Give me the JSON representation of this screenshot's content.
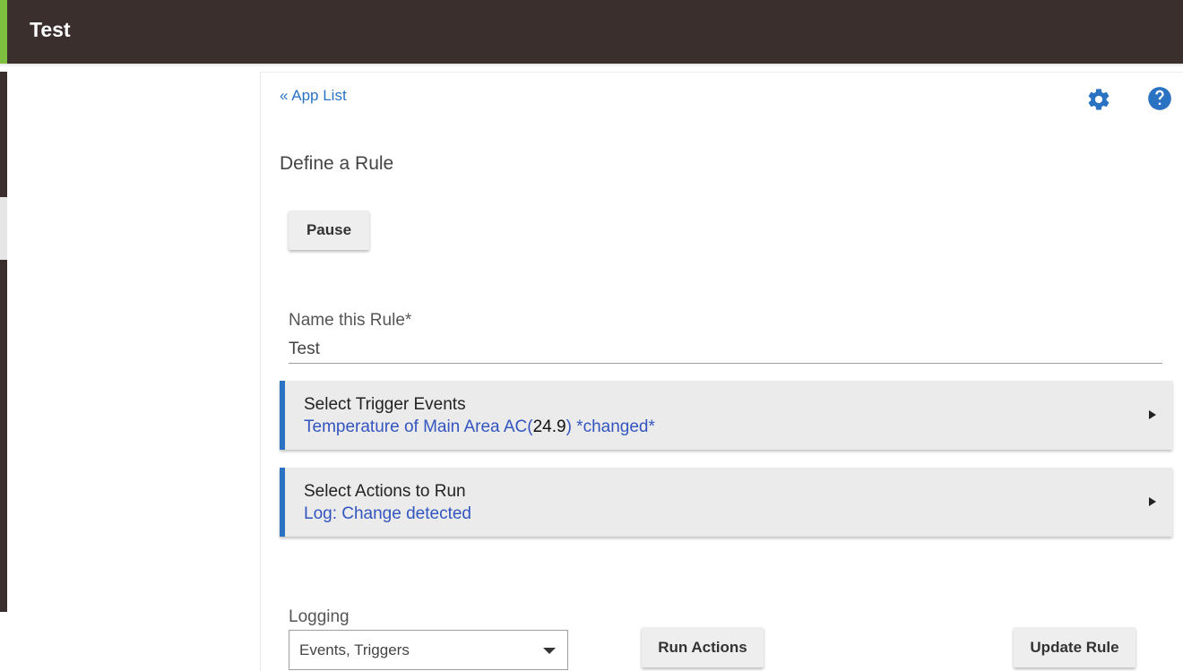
{
  "header": {
    "title": "Test"
  },
  "nav": {
    "app_list_label": "« App List"
  },
  "icons": {
    "settings": "gear-icon",
    "help": "help-icon"
  },
  "page": {
    "title": "Define a Rule"
  },
  "buttons": {
    "pause_label": "Pause",
    "run_actions_label": "Run Actions",
    "update_rule_label": "Update Rule"
  },
  "rule_name": {
    "label": "Name this Rule*",
    "value": "Test"
  },
  "trigger_section": {
    "title": "Select Trigger Events",
    "desc_prefix": "Temperature of Main Area AC(",
    "desc_value": "24.9",
    "desc_suffix": ") *changed*"
  },
  "actions_section": {
    "title": "Select Actions to Run",
    "desc": "Log: Change detected"
  },
  "logging": {
    "label": "Logging",
    "selected": "Events, Triggers"
  },
  "colors": {
    "header_bg": "#3a2f2c",
    "accent_green": "#7fbf3f",
    "link_blue": "#2a72c2",
    "section_text_blue": "#3355c0"
  }
}
